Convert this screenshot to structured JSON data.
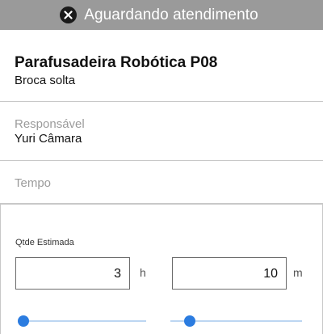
{
  "status_bar": {
    "icon": "close-circle-icon",
    "title": "Aguardando atendimento",
    "color": "#9a9a9a"
  },
  "machine": {
    "name": "Parafusadeira Robótica P08",
    "issue": "Broca solta"
  },
  "responsavel": {
    "label": "Responsável",
    "value": "Yuri Câmara"
  },
  "tempo": {
    "label": "Tempo"
  },
  "estimate": {
    "label": "Qtde Estimada",
    "hours": {
      "value": "3",
      "unit": "h"
    },
    "minutes": {
      "value": "10",
      "unit": "m"
    }
  },
  "sliders": {
    "hours_level": 0.0,
    "minutes_level": 0.15,
    "accent": "#2b7ce0"
  }
}
